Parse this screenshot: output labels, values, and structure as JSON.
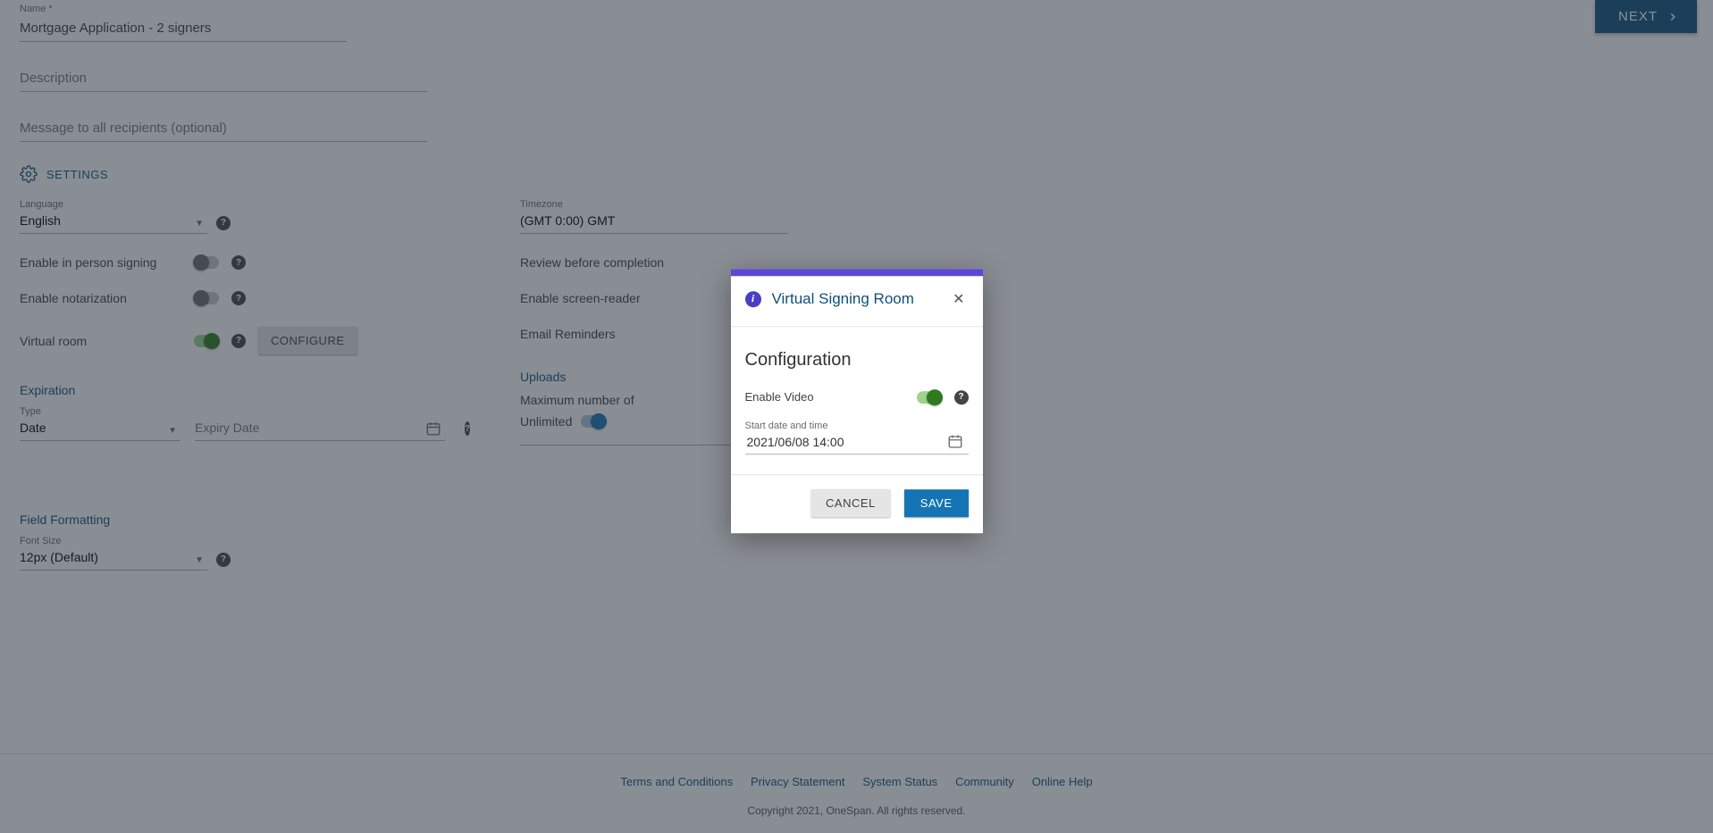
{
  "header": {
    "next_label": "NEXT"
  },
  "form": {
    "name_label": "Name *",
    "name_value": "Mortgage Application - 2 signers",
    "description_placeholder": "Description",
    "message_placeholder": "Message to all recipients (optional)"
  },
  "settings": {
    "header": "SETTINGS",
    "language_label": "Language",
    "language_value": "English",
    "timezone_label": "Timezone",
    "timezone_value": "(GMT 0:00) GMT",
    "in_person_label": "Enable in person signing",
    "notarization_label": "Enable notarization",
    "virtual_room_label": "Virtual room",
    "configure_label": "CONFIGURE",
    "review_label": "Review before completion",
    "screenreader_label": "Enable screen-reader",
    "reminders_label": "Email Reminders"
  },
  "expiration": {
    "title": "Expiration",
    "type_label": "Type",
    "type_value": "Date",
    "expiry_placeholder": "Expiry Date"
  },
  "uploads": {
    "title": "Uploads",
    "max_label": "Maximum number of",
    "unlimited_label": "Unlimited"
  },
  "formatting": {
    "title": "Field Formatting",
    "fontsize_label": "Font Size",
    "fontsize_value": "12px (Default)"
  },
  "footer": {
    "links": [
      "Terms and Conditions",
      "Privacy Statement",
      "System Status",
      "Community",
      "Online Help"
    ],
    "copyright": "Copyright 2021, OneSpan. All rights reserved."
  },
  "modal": {
    "title": "Virtual Signing Room",
    "config_heading": "Configuration",
    "enable_video_label": "Enable Video",
    "start_label": "Start date and time",
    "start_value": "2021/06/08 14:00",
    "cancel_label": "CANCEL",
    "save_label": "SAVE"
  }
}
